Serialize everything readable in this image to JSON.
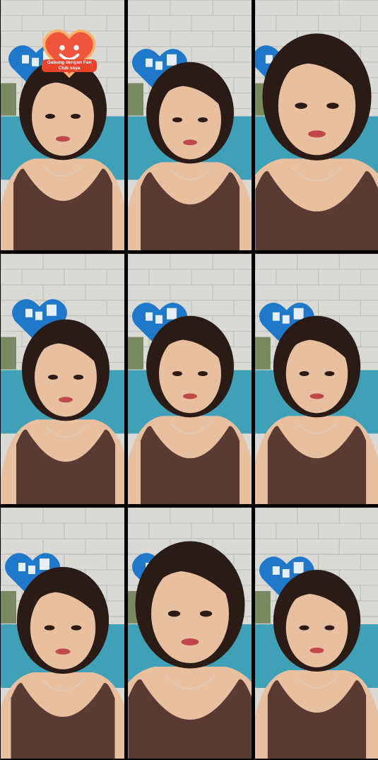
{
  "colors": {
    "background": "#000000",
    "wall": "#d9d9d6",
    "brick_line": "#b9b9b5",
    "blue_heart": "#1f78c9",
    "couch": "#3fa0b8",
    "skin": "#e8c0a0",
    "hair": "#2a1b16",
    "top": "#5a3b33",
    "badge_red": "#e8442c"
  },
  "grid": {
    "rows": 3,
    "columns": 3
  },
  "tiles": [
    {
      "id": "r1c1"
    },
    {
      "id": "r1c2"
    },
    {
      "id": "r1c3"
    },
    {
      "id": "r2c1"
    },
    {
      "id": "r2c2"
    },
    {
      "id": "r2c3"
    },
    {
      "id": "r3c1"
    },
    {
      "id": "r3c2"
    },
    {
      "id": "r3c3"
    }
  ],
  "badge": {
    "icon": "smiling-heart-icon",
    "text": "Gabung dengan Fan\nClub saya"
  }
}
